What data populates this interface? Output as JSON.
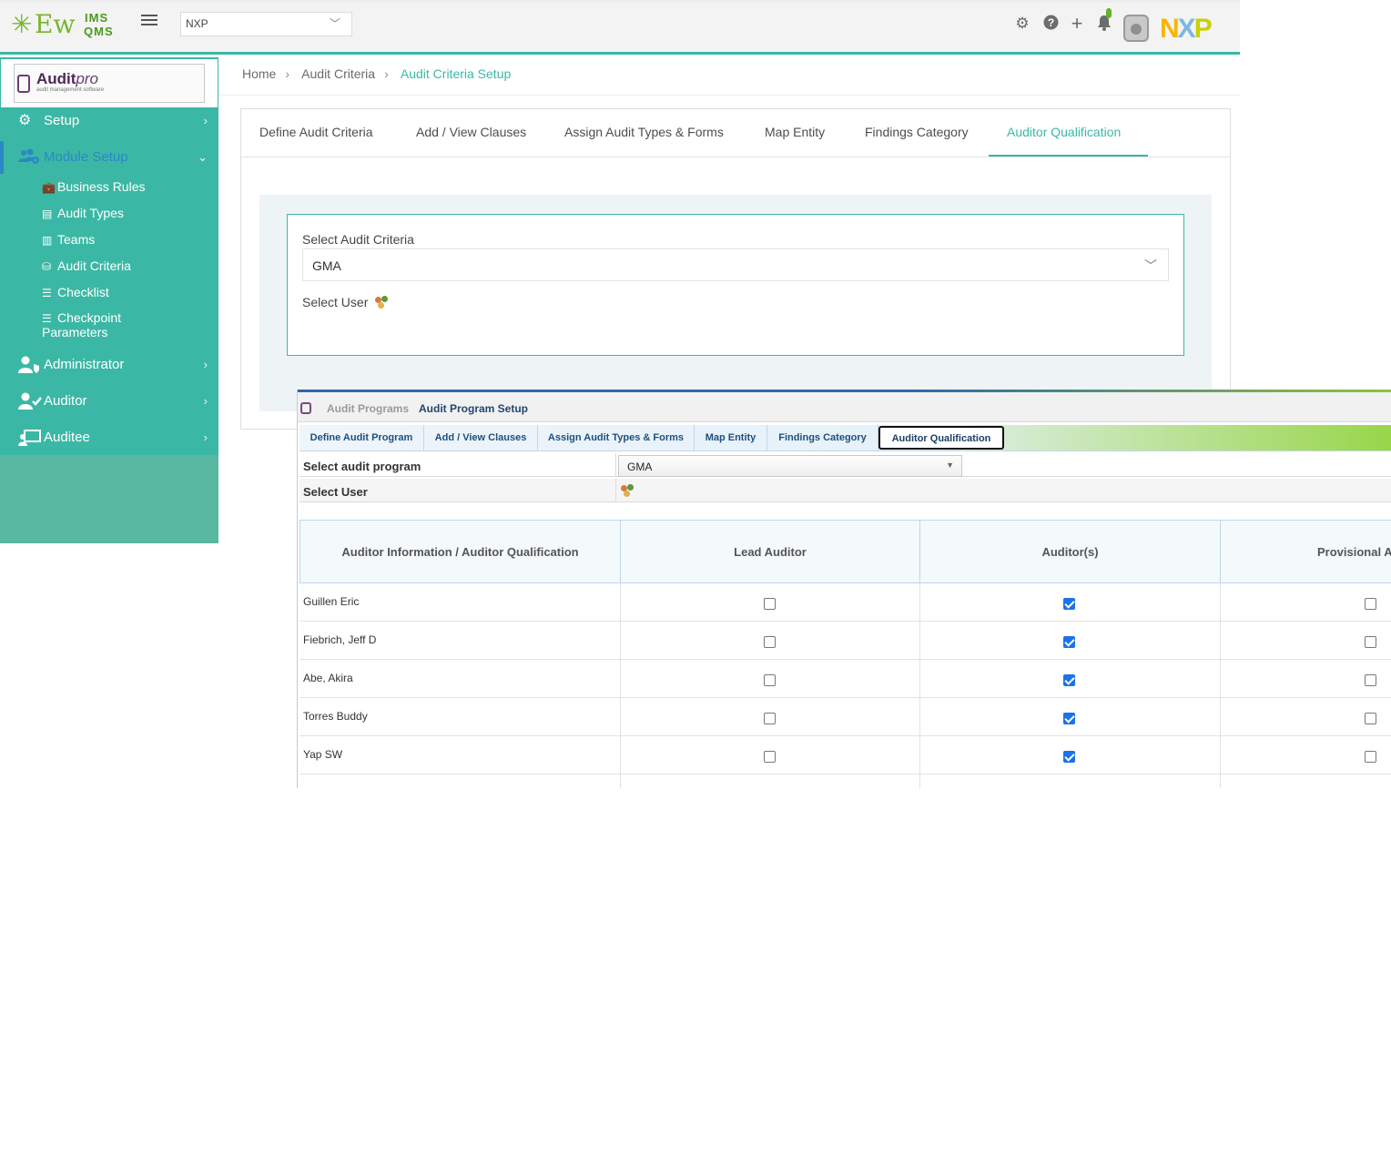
{
  "header": {
    "logo": {
      "main": "Ew",
      "top": "IMS",
      "bottom": "QMS"
    },
    "org_select": "NXP",
    "icons": [
      "gear-icon",
      "help-icon",
      "plus-icon",
      "bell-icon"
    ],
    "brand_logo": {
      "n": "N",
      "x": "X",
      "p": "P"
    },
    "colors": {
      "accent": "#3bb8a5",
      "header_bg": "#f3f3f3"
    }
  },
  "sidebar": {
    "product": {
      "name": "Audit",
      "name_italic": "pro",
      "tagline": "audit management software"
    },
    "items": [
      {
        "label": "Setup",
        "icon": "gear-icon"
      },
      {
        "label": "Module Setup",
        "icon": "users-cog-icon"
      },
      {
        "label": "Administrator",
        "icon": "user-shield-icon"
      },
      {
        "label": "Auditor",
        "icon": "user-check-icon"
      },
      {
        "label": "Auditee",
        "icon": "chalkboard-user-icon"
      }
    ],
    "sub_items": [
      {
        "label": "Business Rules",
        "icon": "briefcase-icon"
      },
      {
        "label": "Audit Types",
        "icon": "list-alt-icon"
      },
      {
        "label": "Teams",
        "icon": "building-icon"
      },
      {
        "label": "Audit Criteria",
        "icon": "sitemap-icon"
      },
      {
        "label": "Checklist",
        "icon": "list-icon"
      },
      {
        "label": "Checkpoint",
        "label2": "Parameters",
        "icon": "tasks-icon"
      }
    ]
  },
  "breadcrumb": {
    "home": "Home",
    "level1": "Audit Criteria",
    "current": "Audit Criteria Setup"
  },
  "tabs": [
    "Define Audit Criteria",
    "Add / View Clauses",
    "Assign Audit Types & Forms",
    "Map Entity",
    "Findings Category",
    "Auditor Qualification"
  ],
  "form": {
    "criteria_label": "Select Audit Criteria",
    "criteria_value": "GMA",
    "user_label": "Select User"
  },
  "legacy": {
    "crumbs": {
      "parent": "Audit Programs",
      "current": "Audit Program Setup"
    },
    "tabs": [
      "Define Audit Program",
      "Add / View Clauses",
      "Assign Audit Types & Forms",
      "Map Entity",
      "Findings Category",
      "Auditor Qualification"
    ],
    "program_label": "Select audit program",
    "program_value": "GMA",
    "user_label": "Select User",
    "columns": [
      "Auditor Information / Auditor Qualification",
      "Lead Auditor",
      "Auditor(s)",
      "Provisional A"
    ],
    "rows": [
      {
        "name": "Guillen Eric",
        "lead": false,
        "auditor": true,
        "provisional": false
      },
      {
        "name": "Fiebrich, Jeff D",
        "lead": false,
        "auditor": true,
        "provisional": false
      },
      {
        "name": "Abe, Akira",
        "lead": false,
        "auditor": true,
        "provisional": false
      },
      {
        "name": "Torres Buddy",
        "lead": false,
        "auditor": true,
        "provisional": false
      },
      {
        "name": "Yap SW",
        "lead": false,
        "auditor": true,
        "provisional": false
      }
    ]
  }
}
